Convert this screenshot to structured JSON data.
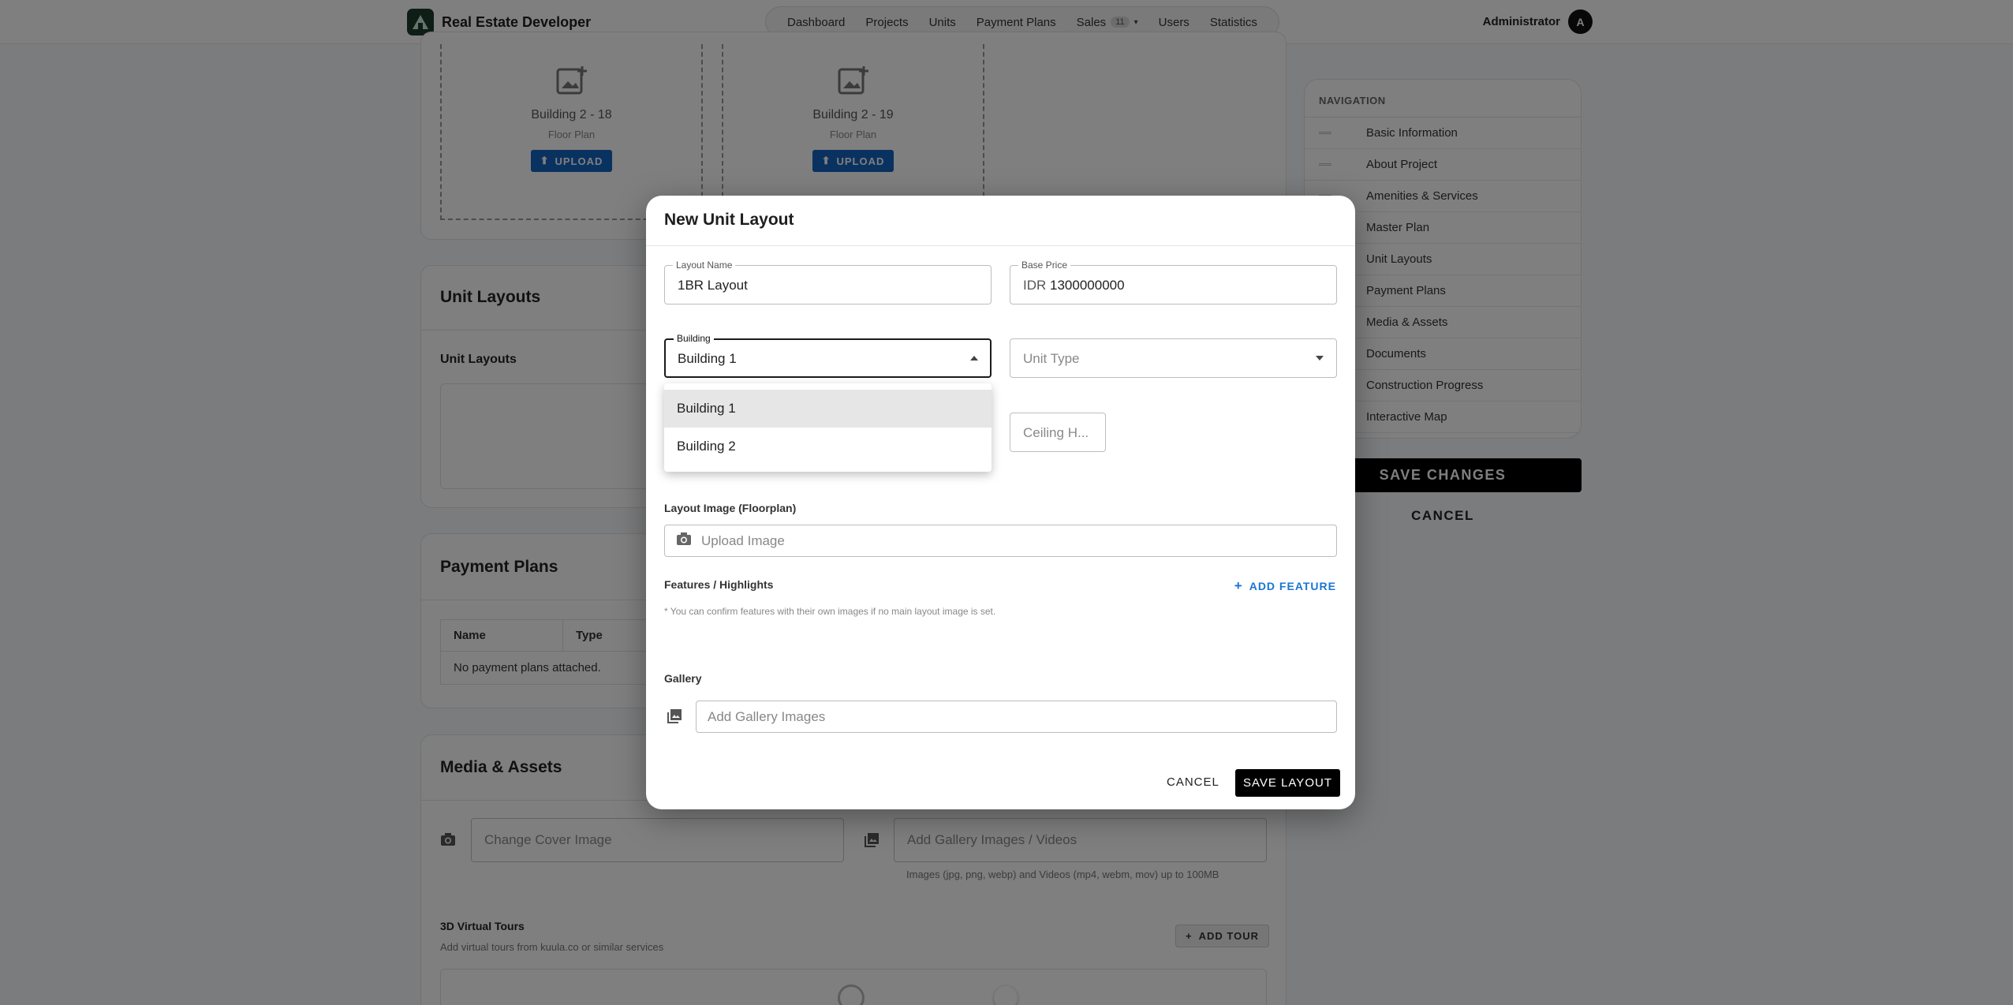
{
  "header": {
    "brand": "Real Estate Developer",
    "nav": [
      {
        "label": "Dashboard"
      },
      {
        "label": "Projects"
      },
      {
        "label": "Units"
      },
      {
        "label": "Payment Plans"
      },
      {
        "label": "Sales",
        "badge": "11"
      },
      {
        "label": "Users"
      },
      {
        "label": "Statistics"
      }
    ],
    "user": "Administrator",
    "avatar_initial": "A"
  },
  "floor_plans": [
    {
      "name": "Building 2 - 18",
      "sub": "Floor Plan",
      "button": "UPLOAD"
    },
    {
      "name": "Building 2 - 19",
      "sub": "Floor Plan",
      "button": "UPLOAD"
    }
  ],
  "unit_layouts": {
    "title": "Unit Layouts",
    "subtitle": "Unit Layouts"
  },
  "payment_plans": {
    "title": "Payment Plans",
    "columns": [
      "Name",
      "Type"
    ],
    "empty": "No payment plans attached."
  },
  "media": {
    "title": "Media & Assets",
    "cover_placeholder": "Change Cover Image",
    "gallery_placeholder": "Add Gallery Images / Videos",
    "gallery_hint": "Images (jpg, png, webp) and Videos (mp4, webm, mov) up to 100MB",
    "tours_title": "3D Virtual Tours",
    "tours_hint": "Add virtual tours from kuula.co or similar services",
    "add_tour": "ADD TOUR"
  },
  "side_nav": {
    "heading": "NAVIGATION",
    "items": [
      "Basic Information",
      "About Project",
      "Amenities & Services",
      "Master Plan",
      "Unit Layouts",
      "Payment Plans",
      "Media & Assets",
      "Documents",
      "Construction Progress",
      "Interactive Map"
    ],
    "save": "SAVE CHANGES",
    "cancel": "CANCEL"
  },
  "dialog": {
    "title": "New Unit Layout",
    "layout_name": {
      "label": "Layout Name",
      "value": "1BR Layout"
    },
    "base_price": {
      "label": "Base Price",
      "prefix": "IDR",
      "value": "1300000000"
    },
    "building": {
      "label": "Building",
      "value": "Building 1",
      "options": [
        "Building 1",
        "Building 2"
      ]
    },
    "unit_type": {
      "placeholder": "Unit Type"
    },
    "ceiling_placeholder": "Ceiling H...",
    "layout_image_label": "Layout Image (Floorplan)",
    "upload_image_placeholder": "Upload Image",
    "features_label": "Features / Highlights",
    "add_feature": "ADD FEATURE",
    "features_note": "* You can confirm features with their own images if no main layout image is set.",
    "gallery_label": "Gallery",
    "gallery_placeholder": "Add Gallery Images",
    "cancel": "CANCEL",
    "save": "SAVE LAYOUT"
  }
}
